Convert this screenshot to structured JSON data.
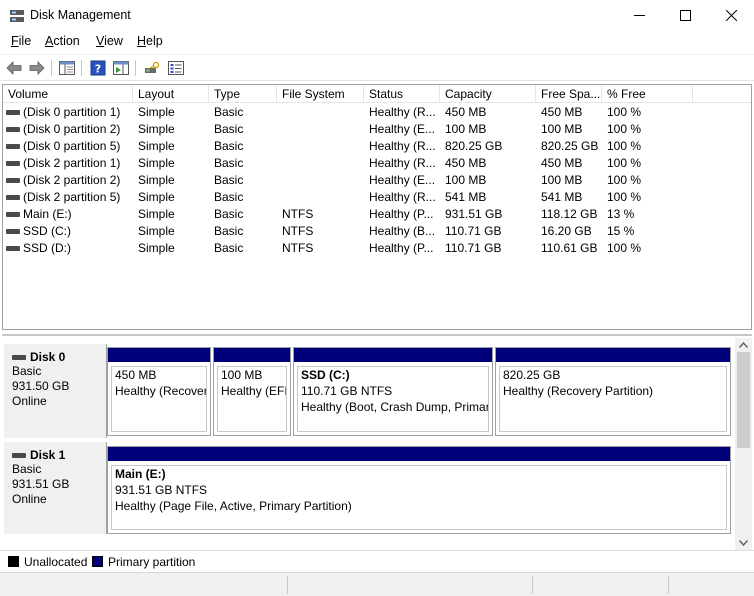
{
  "window": {
    "title": "Disk Management"
  },
  "menu": [
    {
      "label": "File",
      "u": "F",
      "rest": "ile"
    },
    {
      "label": "Action",
      "u": "A",
      "rest": "ction"
    },
    {
      "label": "View",
      "u": "V",
      "rest": "iew"
    },
    {
      "label": "Help",
      "u": "H",
      "rest": "elp"
    }
  ],
  "columns": [
    "Volume",
    "Layout",
    "Type",
    "File System",
    "Status",
    "Capacity",
    "Free Spa...",
    "% Free"
  ],
  "volumes": [
    [
      "(Disk 0 partition 1)",
      "Simple",
      "Basic",
      "",
      "Healthy (R...",
      "450 MB",
      "450 MB",
      "100 %"
    ],
    [
      "(Disk 0 partition 2)",
      "Simple",
      "Basic",
      "",
      "Healthy (E...",
      "100 MB",
      "100 MB",
      "100 %"
    ],
    [
      "(Disk 0 partition 5)",
      "Simple",
      "Basic",
      "",
      "Healthy (R...",
      "820.25 GB",
      "820.25 GB",
      "100 %"
    ],
    [
      "(Disk 2 partition 1)",
      "Simple",
      "Basic",
      "",
      "Healthy (R...",
      "450 MB",
      "450 MB",
      "100 %"
    ],
    [
      "(Disk 2 partition 2)",
      "Simple",
      "Basic",
      "",
      "Healthy (E...",
      "100 MB",
      "100 MB",
      "100 %"
    ],
    [
      "(Disk 2 partition 5)",
      "Simple",
      "Basic",
      "",
      "Healthy (R...",
      "541 MB",
      "541 MB",
      "100 %"
    ],
    [
      "Main (E:)",
      "Simple",
      "Basic",
      "NTFS",
      "Healthy (P...",
      "931.51 GB",
      "118.12 GB",
      "13 %"
    ],
    [
      "SSD (C:)",
      "Simple",
      "Basic",
      "NTFS",
      "Healthy (B...",
      "110.71 GB",
      "16.20 GB",
      "15 %"
    ],
    [
      "SSD (D:)",
      "Simple",
      "Basic",
      "NTFS",
      "Healthy (P...",
      "110.71 GB",
      "110.61 GB",
      "100 %"
    ]
  ],
  "disks": [
    {
      "name": "Disk 0",
      "type": "Basic",
      "size": "931.50 GB",
      "status": "Online",
      "partitions": [
        {
          "title": "",
          "line1": "450 MB",
          "line2": "Healthy (Recover"
        },
        {
          "title": "",
          "line1": "100 MB",
          "line2": "Healthy (EFI"
        },
        {
          "title": "SSD  (C:)",
          "line1": "110.71 GB NTFS",
          "line2": "Healthy (Boot, Crash Dump, Primar"
        },
        {
          "title": "",
          "line1": "820.25 GB",
          "line2": "Healthy (Recovery Partition)"
        }
      ]
    },
    {
      "name": "Disk 1",
      "type": "Basic",
      "size": "931.51 GB",
      "status": "Online",
      "partitions": [
        {
          "title": "Main  (E:)",
          "line1": "931.51 GB NTFS",
          "line2": "Healthy (Page File, Active, Primary Partition)"
        }
      ]
    }
  ],
  "legend": [
    {
      "label": "Unallocated",
      "color": "#000000"
    },
    {
      "label": "Primary partition",
      "color": "#00007b"
    }
  ],
  "colors": {
    "primary_partition": "#00007b",
    "unallocated": "#000000"
  }
}
